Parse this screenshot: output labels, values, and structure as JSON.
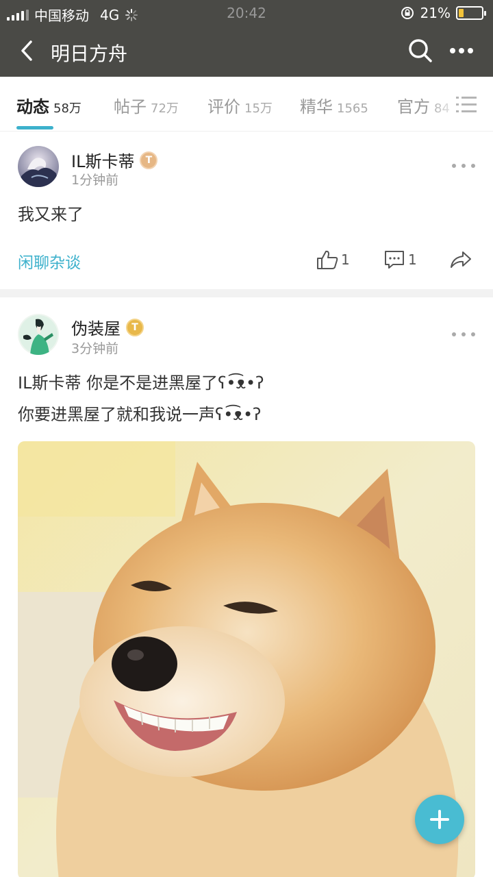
{
  "status_bar": {
    "carrier": "中国移动",
    "network": "4G",
    "time": "20:42",
    "battery_percent": "21%",
    "battery_level": 0.21
  },
  "nav": {
    "title": "明日方舟"
  },
  "tabs": [
    {
      "name": "动态",
      "count": "58万",
      "active": true
    },
    {
      "name": "帖子",
      "count": "72万",
      "active": false
    },
    {
      "name": "评价",
      "count": "15万",
      "active": false
    },
    {
      "name": "精华",
      "count": "1565",
      "active": false
    },
    {
      "name": "官方",
      "count": "84",
      "active": false
    }
  ],
  "posts": [
    {
      "author": "IL斯卡蒂",
      "badge": "T",
      "time": "1分钟前",
      "text": "我又来了",
      "category": "闲聊杂谈",
      "likes": "1",
      "comments": "1"
    },
    {
      "author": "伪装屋",
      "badge": "T",
      "time": "3分钟前",
      "lines": [
        "IL斯卡蒂 你是不是进黑屋了ʕ•͡ᴥ•ʔ",
        "你要进黑屋了就和我说一声ʕ•͡ᴥ•ʔ"
      ]
    }
  ],
  "colors": {
    "accent": "#3db1cc",
    "header": "#4a4a46",
    "fab": "#49bcd2"
  }
}
